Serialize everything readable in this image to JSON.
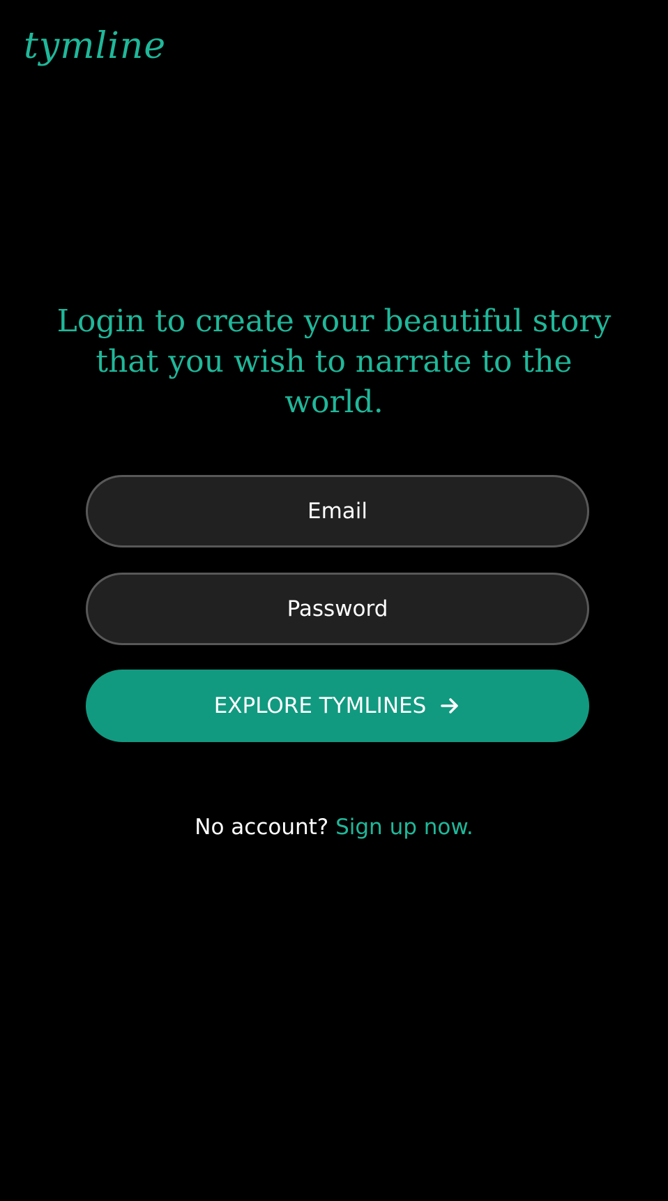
{
  "brand": {
    "logo_text": "tymline",
    "accent_color": "#1fb89a"
  },
  "headline": "Login to create your beautiful story that you wish to narrate to the world.",
  "form": {
    "email_placeholder": "Email",
    "email_value": "",
    "password_placeholder": "Password",
    "password_value": "",
    "submit_label": "EXPLORE TYMLINES",
    "submit_icon": "arrow-right-icon",
    "submit_color": "#119a80"
  },
  "footer": {
    "prompt_text": "No account?",
    "signup_link_text": "Sign up now."
  }
}
